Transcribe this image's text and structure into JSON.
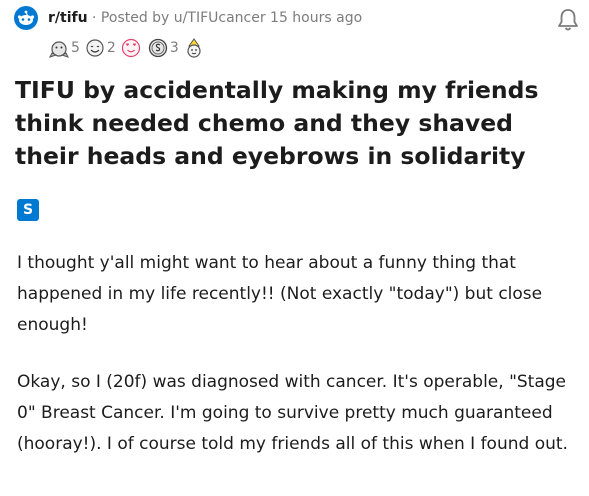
{
  "header": {
    "subreddit": "r/tifu",
    "posted_by": "· Posted by u/TIFUcancer 15 hours ago"
  },
  "awards": [
    {
      "icon": "silver-award-icon",
      "count": "5"
    },
    {
      "icon": "wholesome-award-icon",
      "count": "2"
    },
    {
      "icon": "heart-eyes-award-icon",
      "count": ""
    },
    {
      "icon": "coin-award-icon",
      "count": "3"
    },
    {
      "icon": "party-award-icon",
      "count": ""
    }
  ],
  "post": {
    "title": "TIFU by accidentally making my friends think needed chemo and they shaved their heads and eyebrows in solidarity",
    "flair": "S",
    "paragraphs": [
      "I thought y'all might want to hear about a funny thing that happened in my life recently!! (Not exactly \"today\") but close enough!",
      "Okay, so I (20f) was diagnosed with cancer. It's operable, \"Stage 0\" Breast Cancer. I'm going to survive pretty much guaranteed (hooray!). I of course told my friends all of this when I found out."
    ]
  },
  "colors": {
    "accent": "#0079d3",
    "meta_text": "#7c7c7c",
    "body_text": "#1c1c1c"
  }
}
